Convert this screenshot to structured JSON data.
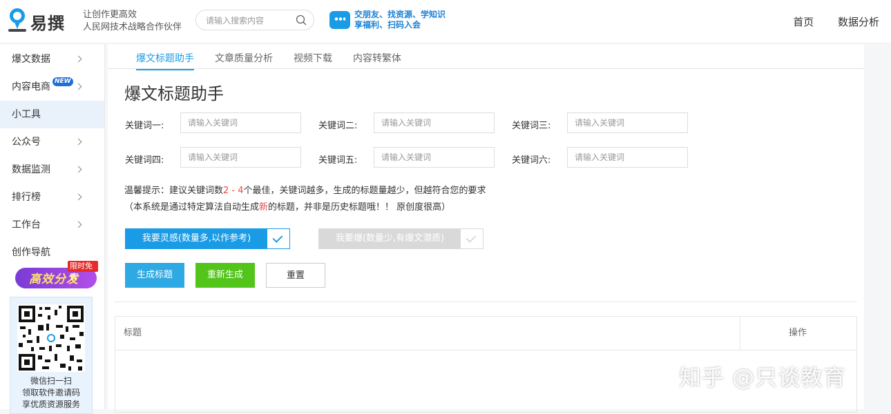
{
  "header": {
    "brand": "易撰",
    "slogan_line1": "让创作更高效",
    "slogan_line2": "人民网技术战略合作伙伴",
    "search_placeholder": "请输入搜索内容",
    "promo_line1": "交朋友、找资源、学知识",
    "promo_line2": "享福利、扫码入会",
    "nav": [
      "首页",
      "数据分析"
    ]
  },
  "sidebar": {
    "items": [
      {
        "label": "爆文数据",
        "chevron": true
      },
      {
        "label": "内容电商",
        "chevron": true,
        "badge": "NEW"
      },
      {
        "label": "小工具",
        "chevron": false,
        "active": true
      },
      {
        "label": "公众号",
        "chevron": true
      },
      {
        "label": "数据监测",
        "chevron": true
      },
      {
        "label": "排行榜",
        "chevron": true
      },
      {
        "label": "工作台",
        "chevron": true
      },
      {
        "label": "创作导航",
        "chevron": false
      }
    ],
    "banner_text": "高效分发",
    "banner_ribbon": "限时免费",
    "qr_lines": [
      "微信扫一扫",
      "领取软件邀请码",
      "享优质资源服务"
    ]
  },
  "tabs": [
    "爆文标题助手",
    "文章质量分析",
    "视频下载",
    "内容转繁体"
  ],
  "page_title": "爆文标题助手",
  "keywords": {
    "labels": [
      "关键词一:",
      "关键词二:",
      "关键词三:",
      "关键词四:",
      "关键词五:",
      "关键词六:"
    ],
    "placeholder": "请输入关键词"
  },
  "tip": {
    "line1_a": "温馨提示：建议关键词数",
    "line1_red": "2 - 4",
    "line1_b": "个最佳，关键词越多，生成的标题量越少，但越符合您的要求",
    "line2_a": "（本系统是通过特定算法自动生成",
    "line2_red": "新",
    "line2_b": "的标题，并非是历史标题哦！！ 原创度很高）"
  },
  "modes": {
    "inspiration": "我要灵感(数量多,以作参考)",
    "hot": "我要爆(数量少,有爆文潜质)"
  },
  "buttons": {
    "generate": "生成标题",
    "regenerate": "重新生成",
    "reset": "重置"
  },
  "table": {
    "col_title": "标题",
    "col_action": "操作"
  },
  "watermark": "知乎 @只谈教育",
  "colors": {
    "accent": "#1a9be6",
    "green": "#52c41a",
    "red": "#e84a4a",
    "disabled": "#d9d9d9"
  }
}
